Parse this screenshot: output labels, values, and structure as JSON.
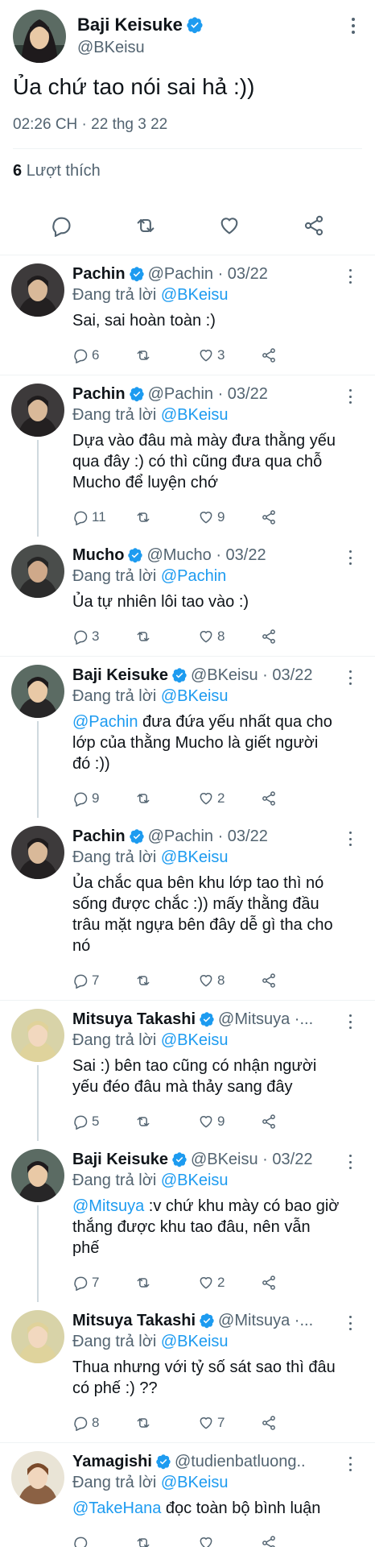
{
  "main_tweet": {
    "name": "Baji Keisuke",
    "handle": "@BKeisu",
    "text": "Ủa chứ tao nói sai hả :))",
    "time": "02:26 CH · 22 thg 3 22",
    "likes_count": "6",
    "likes_label": "Lượt thích"
  },
  "replies": [
    {
      "name": "Pachin",
      "meta": "@Pachin · 03/22",
      "replying_label": "Đang trả lời",
      "replying_to": "@BKeisu",
      "mention": "",
      "text": "Sai, sai hoàn toàn :)",
      "replies": "6",
      "retweets": "",
      "likes": "3"
    },
    {
      "name": "Pachin",
      "meta": "@Pachin · 03/22",
      "replying_label": "Đang trả lời",
      "replying_to": "@BKeisu",
      "mention": "",
      "text": "Dựa vào đâu mà mày đưa thằng yếu qua đây :) có thì cũng đưa qua chỗ Mucho để luyện chớ",
      "replies": "11",
      "retweets": "",
      "likes": "9"
    },
    {
      "name": "Mucho",
      "meta": "@Mucho · 03/22",
      "replying_label": "Đang trả lời",
      "replying_to": "@Pachin",
      "mention": "",
      "text": "Ủa tự nhiên lôi tao vào :)",
      "replies": "3",
      "retweets": "",
      "likes": "8"
    },
    {
      "name": "Baji Keisuke",
      "meta": "@BKeisu · 03/22",
      "replying_label": "Đang trả lời",
      "replying_to": "@BKeisu",
      "mention": "@Pachin",
      "text": " đưa đứa yếu nhất qua cho lớp của thằng Mucho là giết người đó :))",
      "replies": "9",
      "retweets": "",
      "likes": "2"
    },
    {
      "name": "Pachin",
      "meta": "@Pachin · 03/22",
      "replying_label": "Đang trả lời",
      "replying_to": "@BKeisu",
      "mention": "",
      "text": "Ủa chắc qua bên khu lớp tao thì nó sống được chắc :)) mấy thằng đầu trâu mặt ngựa bên đây dễ gì tha cho nó",
      "replies": "7",
      "retweets": "",
      "likes": "8"
    },
    {
      "name": "Mitsuya Takashi",
      "meta": "@Mitsuya ·...",
      "replying_label": "Đang trả lời",
      "replying_to": "@BKeisu",
      "mention": "",
      "text": "Sai :) bên tao cũng có nhận người yếu đéo đâu mà thảy sang đây",
      "replies": "5",
      "retweets": "",
      "likes": "9"
    },
    {
      "name": "Baji Keisuke",
      "meta": "@BKeisu · 03/22",
      "replying_label": "Đang trả lời",
      "replying_to": "@BKeisu",
      "mention": "@Mitsuya",
      "text": " :v chứ khu mày có bao giờ thắng được khu tao đâu, nên vẫn phế",
      "replies": "7",
      "retweets": "",
      "likes": "2"
    },
    {
      "name": "Mitsuya Takashi",
      "meta": "@Mitsuya ·...",
      "replying_label": "Đang trả lời",
      "replying_to": "@BKeisu",
      "mention": "",
      "text": "Thua nhưng với tỷ số sát sao thì đâu có phế :) ??",
      "replies": "8",
      "retweets": "",
      "likes": "7"
    },
    {
      "name": "Yamagishi",
      "meta": "@tudienbatluong..",
      "replying_label": "Đang trả lời",
      "replying_to": "@BKeisu",
      "mention": "@TakeHana",
      "text": " đọc toàn bộ bình luận",
      "replies": "",
      "retweets": "",
      "likes": ""
    }
  ],
  "colors": {
    "accent": "#1d9bf0",
    "text": "#0f1419",
    "secondary": "#536471",
    "line": "#cfd9de"
  },
  "icons": [
    "verified-badge-icon",
    "more-icon",
    "reply-icon",
    "retweet-icon",
    "like-icon",
    "share-icon"
  ]
}
